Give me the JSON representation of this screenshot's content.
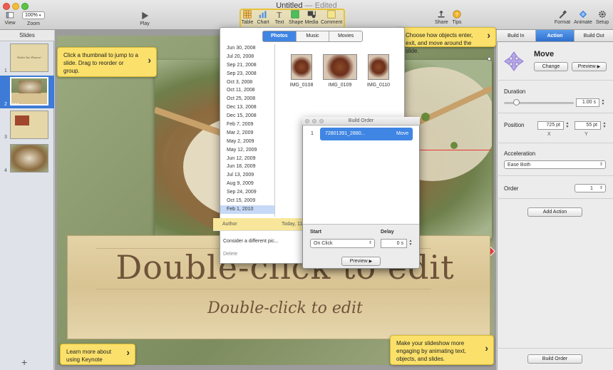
{
  "window": {
    "title": "Untitled",
    "edited": "— Edited"
  },
  "toolbar": {
    "view": "View",
    "zoom_label": "Zoom",
    "zoom_value": "100%",
    "play": "Play",
    "table": "Table",
    "chart": "Chart",
    "text": "Text",
    "shape": "Shape",
    "media": "Media",
    "comment": "Comment",
    "share": "Share",
    "tips": "Tips",
    "format": "Format",
    "animate": "Animate",
    "setup": "Setup"
  },
  "slides": {
    "header": "Slides",
    "items": [
      {
        "num": "1",
        "caption": "Write for Flavor!"
      },
      {
        "num": "2",
        "caption": ""
      },
      {
        "num": "3",
        "caption": ""
      },
      {
        "num": "4",
        "caption": ""
      }
    ],
    "add": "+"
  },
  "tips": {
    "thumbnail": "Click a thumbnail to jump to a slide. Drag to reorder or group.",
    "build": "Choose how objects enter, exit, and move around the slide.",
    "learn": "Learn more about using Keynote",
    "engage": "Make your slideshow more engaging by animating text, objects, and slides."
  },
  "slide": {
    "title": "Double-click to edit",
    "subtitle": "Double-click to edit"
  },
  "media": {
    "tabs": [
      "Photos",
      "Music",
      "Movies"
    ],
    "active_tab": "Photos",
    "dates": [
      "Jun 30, 2008",
      "Jul 20, 2008",
      "Sep 21, 2008",
      "Sep 23, 2008",
      "Oct 3, 2008",
      "Oct 11, 2008",
      "Oct 25, 2008",
      "Dec 13, 2008",
      "Dec 15, 2008",
      "Feb 7, 2009",
      "Mar 2, 2009",
      "May 2, 2009",
      "May 12, 2009",
      "Jun 12, 2009",
      "Jun 18, 2009",
      "Jul 13, 2009",
      "Aug 9, 2009",
      "Sep 24, 2009",
      "Oct 15, 2009",
      "Feb 1, 2010"
    ],
    "selected_date": "Feb 1, 2010",
    "photos": [
      "IMG_0108",
      "IMG_0109",
      "IMG_0110"
    ]
  },
  "comment": {
    "author": "Author",
    "date": "Today, 11",
    "text": "Consider a different pic...",
    "delete": "Delete"
  },
  "build_order": {
    "title": "Build Order",
    "row_num": "1",
    "row_name": "72801391_2880...",
    "row_effect": "Move",
    "start_label": "Start",
    "start_value": "On Click",
    "delay_label": "Delay",
    "delay_value": "0 s",
    "preview": "Preview"
  },
  "inspector": {
    "tabs": [
      "Build In",
      "Action",
      "Build Out"
    ],
    "active_tab": "Action",
    "effect": "Move",
    "change": "Change",
    "preview": "Preview",
    "duration_label": "Duration",
    "duration_value": "1.00 s",
    "position_label": "Position",
    "pos_x": "725 pt",
    "pos_y": "55 pt",
    "x_label": "X",
    "y_label": "Y",
    "acceleration_label": "Acceleration",
    "acceleration_value": "Ease Both",
    "order_label": "Order",
    "order_value": "1",
    "add_action": "Add Action",
    "build_order": "Build Order"
  },
  "colors": {
    "accent": "#3f85e3",
    "tip": "#fbe16b",
    "slide_text": "#6e5339"
  }
}
